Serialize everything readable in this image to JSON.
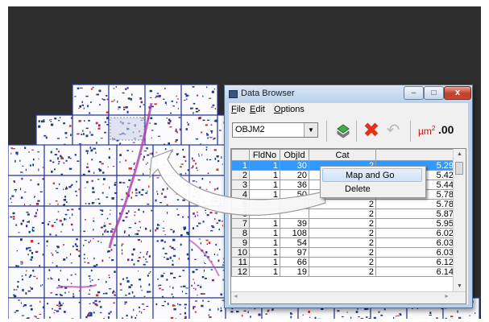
{
  "window": {
    "title": "Data Browser",
    "controls": {
      "minimize": "–",
      "maximize": "□",
      "close": "x"
    }
  },
  "menu": {
    "file": {
      "accel": "F",
      "rest": "ile"
    },
    "edit": {
      "accel": "E",
      "rest": "dit"
    },
    "options": {
      "accel": "O",
      "rest": "ptions"
    }
  },
  "toolbar": {
    "object_select_value": "OBJM2",
    "units_label": "µm",
    "units_power": "2",
    "decimals_label": ".00"
  },
  "table": {
    "columns": [
      "",
      "FldNo",
      "ObjId",
      "Cat",
      ""
    ],
    "rows": [
      [
        "1",
        "1",
        "30",
        "2",
        "5.29"
      ],
      [
        "2",
        "1",
        "20",
        "2",
        "5.42"
      ],
      [
        "3",
        "1",
        "36",
        "2",
        "5.44"
      ],
      [
        "4",
        "1",
        "50",
        "2",
        "5.78"
      ],
      [
        "5",
        "",
        "",
        "2",
        "5.78"
      ],
      [
        "6",
        "",
        "",
        "2",
        "5.87"
      ],
      [
        "7",
        "1",
        "39",
        "2",
        "5.95"
      ],
      [
        "8",
        "1",
        "108",
        "2",
        "6.02"
      ],
      [
        "9",
        "1",
        "54",
        "2",
        "6.03"
      ],
      [
        "10",
        "1",
        "97",
        "2",
        "6.03"
      ],
      [
        "11",
        "1",
        "66",
        "2",
        "6.12"
      ],
      [
        "12",
        "1",
        "19",
        "2",
        "6.14"
      ]
    ],
    "selected_row": 0
  },
  "context_menu": {
    "items": [
      "Map and Go",
      "Delete"
    ]
  },
  "icons": {
    "window": "window-icon",
    "go": "map-go-icon",
    "delete": "delete-x-icon",
    "undo": "undo-icon"
  },
  "colors": {
    "selection": "#3399ff",
    "tile_grid": "#2a3a9a",
    "background": "#2e2e2e"
  }
}
